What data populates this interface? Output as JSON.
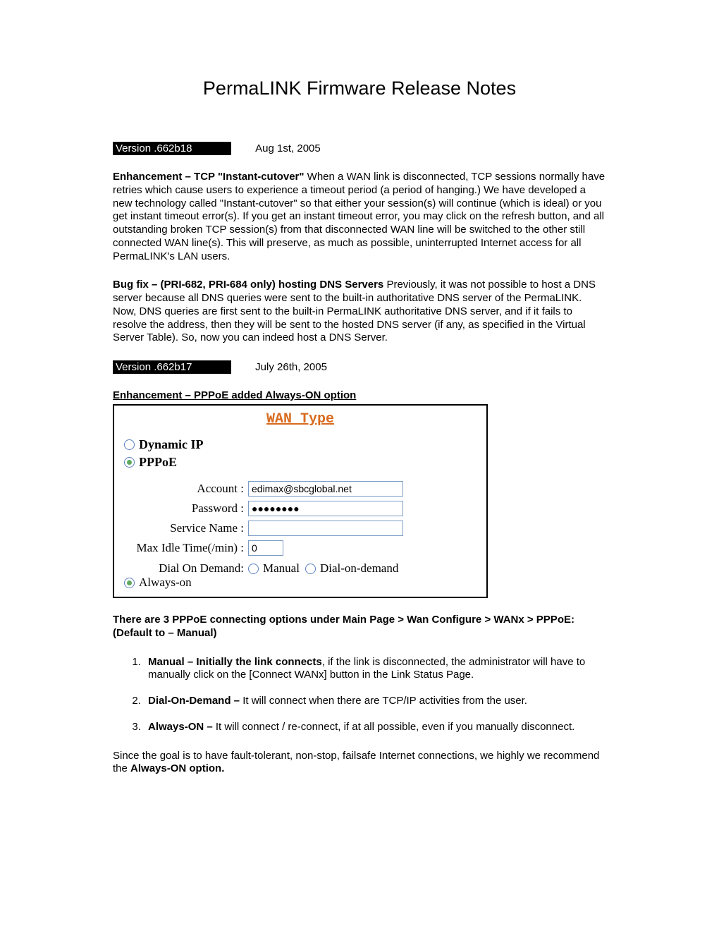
{
  "title": "PermaLINK Firmware Release Notes",
  "v1": {
    "badge": "Version .662b18",
    "date": "Aug 1st,  2005",
    "p1_bold": "Enhancement – TCP \"Instant-cutover\" ",
    "p1_rest": "When a WAN link is disconnected, TCP sessions normally have retries which cause users to experience a timeout period (a period of hanging.) We have developed a new technology called \"Instant-cutover\" so that either your session(s) will continue (which is ideal) or you get instant timeout error(s).  If you get an instant timeout error, you may click on the refresh button, and all outstanding broken TCP session(s) from that disconnected WAN line will be switched to the other still connected WAN line(s).  This will preserve, as much as possible, uninterrupted Internet access for all PermaLINK's LAN users.",
    "p2_bold": "Bug fix – (PRI-682, PRI-684 only)  hosting DNS Servers ",
    "p2_rest": "Previously, it was not possible to host a DNS server because all DNS queries were sent to the built-in authoritative DNS server of the PermaLINK.  Now, DNS queries are first sent to the built-in PermaLINK authoritative DNS server, and if it fails to resolve the address, then they will be sent to the hosted DNS server (if any, as specified in the Virtual Server Table).  So, now you can indeed host a DNS Server."
  },
  "v2": {
    "badge": "Version .662b17",
    "date": "July 26th,  2005",
    "head": "Enhancement – PPPoE added Always-ON option"
  },
  "wan": {
    "header": "WAN Type",
    "opt1": "Dynamic IP",
    "opt2": "PPPoE",
    "account_label": "Account :",
    "account_value": "edimax@sbcglobal.net",
    "password_label": "Password :",
    "password_value": "●●●●●●●●",
    "service_label": "Service Name :",
    "service_value": "",
    "idle_label": "Max Idle Time(/min) :",
    "idle_value": "0",
    "dial_label": "Dial On Demand:",
    "dial_opt1": "Manual",
    "dial_opt2": "Dial-on-demand",
    "dial_opt3": "Always-on"
  },
  "post": {
    "p1": "There are 3 PPPoE connecting options under Main Page > Wan Configure > WANx > PPPoE:   (Default  to – Manual)",
    "li1_b": "Manual – Initially the link connects",
    "li1_r": ", if the link is disconnected, the administrator will have to manually click on the [Connect WANx] button in the Link Status Page.",
    "li2_b": "Dial-On-Demand – ",
    "li2_r": "It will connect when there are TCP/IP activities from the user.",
    "li3_b": "Always-ON – ",
    "li3_r": "It will connect / re-connect, if at all possible, even if you manually disconnect.",
    "p2a": "Since the goal is to have fault-tolerant, non-stop, failsafe Internet connections, we highly we recommend the ",
    "p2b": "Always-ON option."
  }
}
